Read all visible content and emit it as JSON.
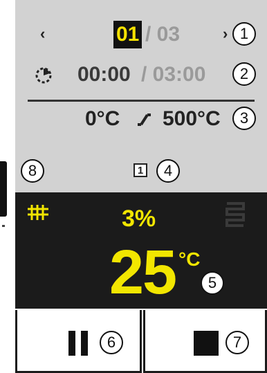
{
  "navigation": {
    "prev_icon": "chevron-left-icon",
    "next_icon": "chevron-right-icon",
    "current_page": "01",
    "total_pages": "/ 03"
  },
  "timer": {
    "icon": "timer-icon",
    "elapsed": "00:00",
    "total": "/ 03:00"
  },
  "temperature_ramp": {
    "start": "0°C",
    "end": "500°C",
    "ramp_icon": "ramp-icon"
  },
  "segment": {
    "number": "1"
  },
  "status": {
    "heating_icon": "heating-grid-icon",
    "cooling_icon": "cooling-coil-icon",
    "power_percent": "3%",
    "current_temp": "25",
    "temp_unit": "°C"
  },
  "controls": {
    "pause_icon": "pause-icon",
    "stop_icon": "stop-icon"
  },
  "callouts": {
    "c1": "1",
    "c2": "2",
    "c3": "3",
    "c4": "4",
    "c5": "5",
    "c6": "6",
    "c7": "7",
    "c8": "8"
  },
  "colors": {
    "accent": "#f2e600",
    "panel_bg": "#d2d2d2",
    "dark_bg": "#1b1b1b",
    "muted_text": "#9a9a9a"
  }
}
